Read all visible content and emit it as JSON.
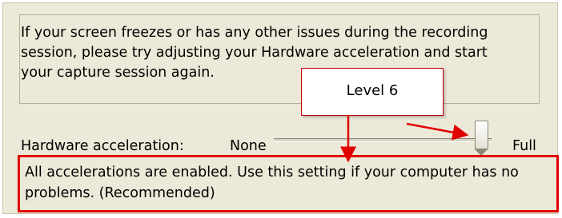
{
  "info": {
    "lines": [
      "If your screen freezes or has any other issues during the recording",
      "session, please try adjusting your Hardware acceleration and start",
      "your capture session again."
    ]
  },
  "hardware_acceleration": {
    "label": "Hardware acceleration:",
    "min_label": "None",
    "max_label": "Full",
    "level": 6,
    "max_level": 6
  },
  "callout": {
    "text": "Level 6"
  },
  "description": {
    "lines": [
      "All accelerations are enabled. Use this setting if your computer has no",
      "problems. (Recommended)"
    ]
  },
  "colors": {
    "callout_border": "#cc0000",
    "highlight_border": "#e00000",
    "panel_background": "#ede9d8"
  }
}
